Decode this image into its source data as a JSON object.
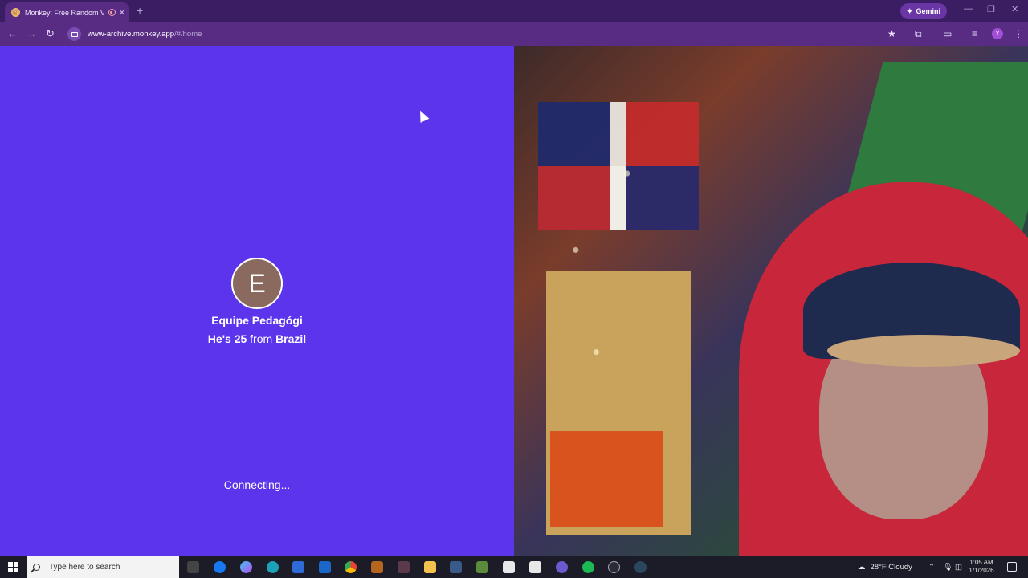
{
  "browser": {
    "tab": {
      "title": "Monkey: Free Random Vide",
      "close_glyph": "×"
    },
    "new_tab_glyph": "+",
    "gemini_label": "Gemini",
    "gemini_icon": "sparkle-icon",
    "window_controls": [
      "—",
      "❐",
      "✕"
    ],
    "nav": {
      "back": "←",
      "forward": "→",
      "reload": "↻"
    },
    "url_host": "www-archive.monkey.app",
    "url_path": "/#/home",
    "tools": {
      "bookmark": "★",
      "extensions": "⧉",
      "cast": "▭",
      "media": "≡",
      "menu": "⋮"
    },
    "profile_initial": "Y"
  },
  "page": {
    "peer": {
      "avatar_initial": "E",
      "name": "Equipe Pedagógi",
      "prefix": "He's",
      "age": "25",
      "from_word": "from",
      "country": "Brazil"
    },
    "status": "Connecting..."
  },
  "taskbar": {
    "search_placeholder": "Type here to search",
    "weather": "28°F  Cloudy",
    "time": "1:05 AM",
    "date": "1/1/2026"
  },
  "colors": {
    "left_pane_bg": "#5b34ec",
    "chrome_dark": "#3b1d63",
    "chrome_addr": "#582c83"
  }
}
